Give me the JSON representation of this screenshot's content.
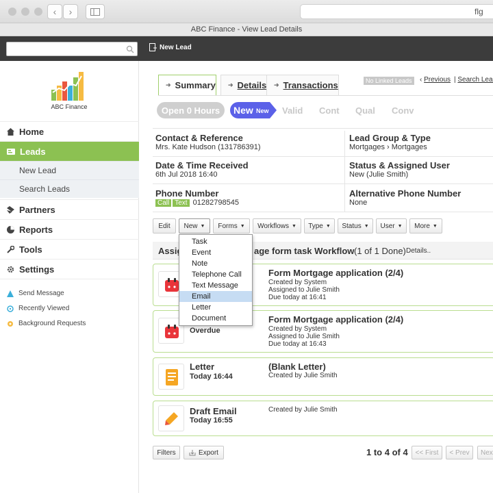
{
  "browser": {
    "address_text": "flg",
    "window_title": "ABC Finance - View Lead Details"
  },
  "topbar": {
    "search_placeholder": "",
    "new_lead_label": "New Lead"
  },
  "brand": {
    "name": "ABC Finance",
    "accent_color": "#8cc152"
  },
  "sidebar": {
    "items": [
      {
        "label": "Home",
        "icon": "home-icon"
      },
      {
        "label": "Leads",
        "icon": "leads-icon"
      },
      {
        "label": "Partners",
        "icon": "partners-icon"
      },
      {
        "label": "Reports",
        "icon": "reports-icon"
      },
      {
        "label": "Tools",
        "icon": "tools-icon"
      },
      {
        "label": "Settings",
        "icon": "settings-icon"
      }
    ],
    "sub_items": [
      {
        "label": "New Lead"
      },
      {
        "label": "Search Leads"
      }
    ],
    "small_items": [
      {
        "label": "Send Message",
        "icon": "message-icon"
      },
      {
        "label": "Recently Viewed",
        "icon": "recent-icon"
      },
      {
        "label": "Background Requests",
        "icon": "background-icon"
      }
    ]
  },
  "tabs": [
    {
      "label": "Summary",
      "active": true
    },
    {
      "label": "Details"
    },
    {
      "label": "Transactions"
    }
  ],
  "right_links": {
    "linked_badge": "No Linked Leads",
    "previous": "Previous",
    "search_leads": "Search Leads"
  },
  "status_pipeline": {
    "open": "Open 0 Hours",
    "current": "New",
    "current_sub": "New",
    "steps": [
      "Valid",
      "Cont",
      "Qual",
      "Conv"
    ]
  },
  "info": {
    "contact_label": "Contact & Reference",
    "contact_value": "Mrs. Kate Hudson (131786391)",
    "group_label": "Lead Group & Type",
    "group_value": "Mortgages › Mortgages",
    "date_label": "Date & Time Received",
    "date_value": "6th Jul 2018 16:40",
    "status_label": "Status & Assigned User",
    "status_value": "New (Julie Smith)",
    "phone_label": "Phone Number",
    "phone_call": "Call",
    "phone_text": "Text",
    "phone_value": "01282798545",
    "alt_phone_label": "Alternative Phone Number",
    "alt_phone_value": "None"
  },
  "toolbar": {
    "edit": "Edit",
    "new": "New",
    "forms": "Forms",
    "workflows": "Workflows",
    "type": "Type",
    "status": "Status",
    "user": "User",
    "more": "More"
  },
  "workflow": {
    "prefix": "Assig",
    "suffix": "age form task Workflow",
    "count": "(1 of 1 Done)",
    "details": "Details.."
  },
  "dropdown": {
    "items": [
      "Task",
      "Event",
      "Note",
      "Telephone Call",
      "Text Message",
      "Email",
      "Letter",
      "Document"
    ],
    "highlighted": "Email"
  },
  "cards": [
    {
      "title_left": "",
      "sub_left": "",
      "title": "Form Mortgage application (2/4)",
      "line1": "Created by System",
      "line2": "Assigned to Julie Smith",
      "line3": "Due today at 16:41",
      "icon": "calendar-icon"
    },
    {
      "title_left": "",
      "sub_left": "Overdue",
      "title": "Form Mortgage application (2/4)",
      "line1": "Created by System",
      "line2": "Assigned to Julie Smith",
      "line3": "Due today at 16:43",
      "icon": "calendar-icon"
    },
    {
      "title_left": "Letter",
      "sub_left": "Today 16:44",
      "title": "(Blank Letter)",
      "line1": "Created by Julie Smith",
      "line2": "",
      "line3": "",
      "icon": "letter-icon"
    },
    {
      "title_left": "Draft Email",
      "sub_left": "Today 16:55",
      "title": "",
      "line1": "Created by Julie Smith",
      "line2": "",
      "line3": "",
      "icon": "pencil-icon"
    }
  ],
  "footer": {
    "filters": "Filters",
    "export": "Export",
    "range": "1 to 4 of 4",
    "first": "<< First",
    "prev": "< Prev",
    "next": "Next"
  }
}
